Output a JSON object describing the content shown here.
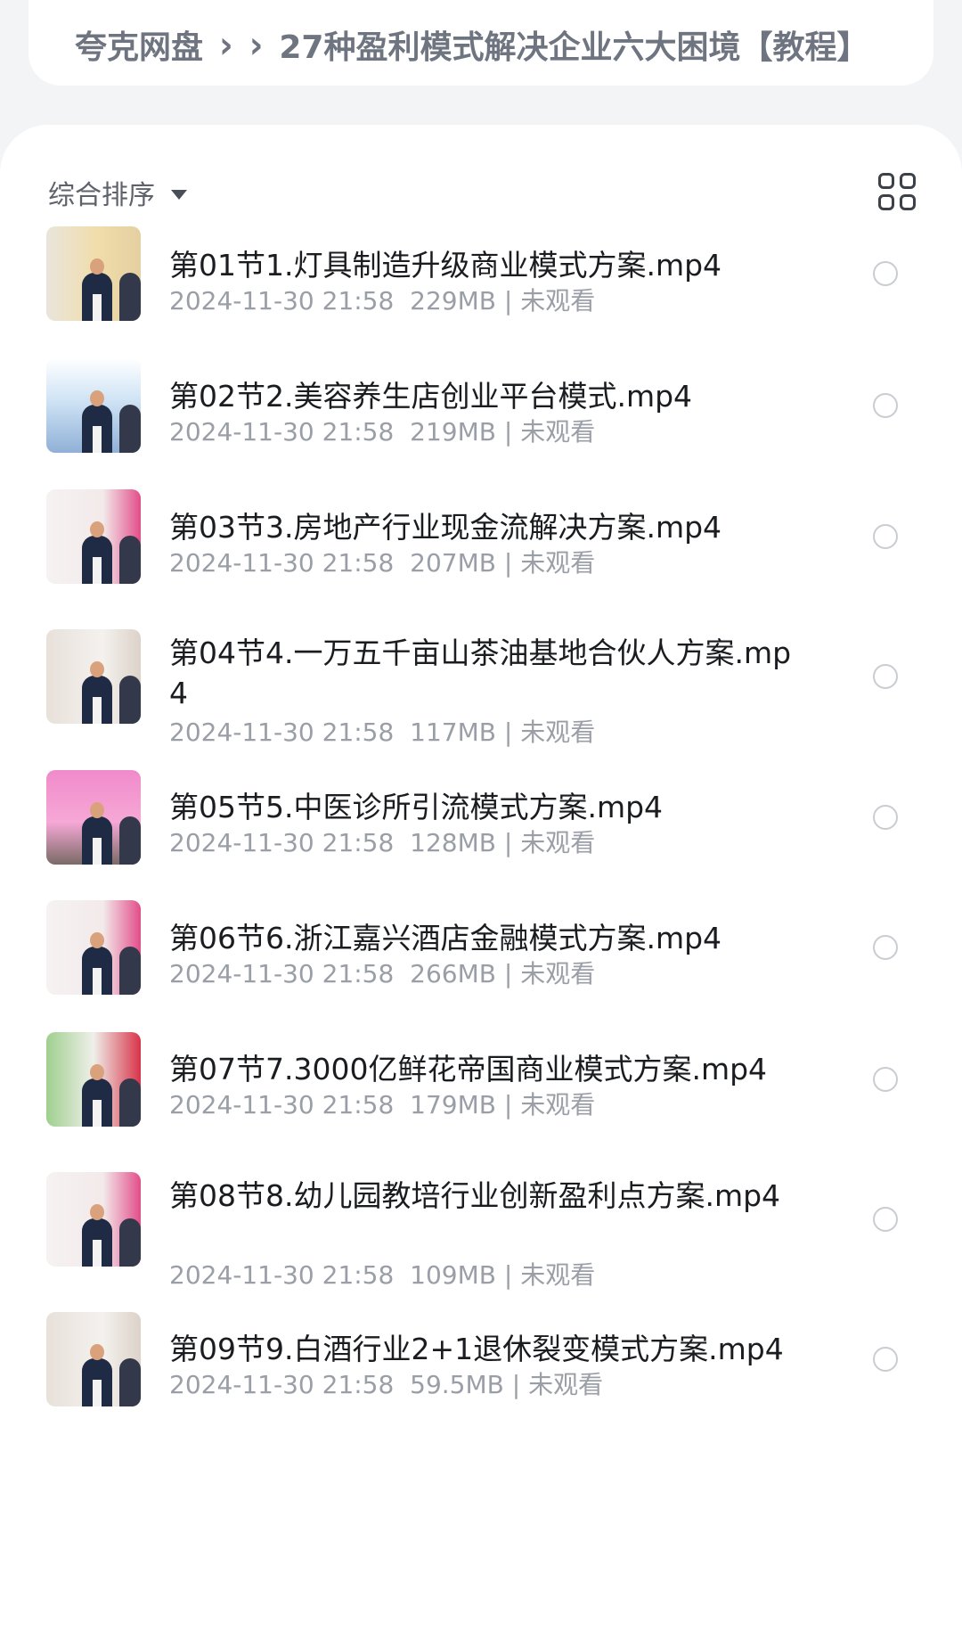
{
  "breadcrumb": {
    "root": "夸克网盘",
    "separator": "›",
    "current": "27种盈利模式解决企业六大困境【教程】"
  },
  "toolbar": {
    "sort_label": "综合排序",
    "view_icon": "grid-view-icon"
  },
  "files": [
    {
      "name": "第01节1.灯具制造升级商业模式方案.mp4",
      "date": "2024-11-30 21:58",
      "size": "229MB",
      "status": "未观看",
      "thumb": "board-yellow"
    },
    {
      "name": "第02节2.美容养生店创业平台模式.mp4",
      "date": "2024-11-30 21:58",
      "size": "219MB",
      "status": "未观看",
      "thumb": "stage-blue"
    },
    {
      "name": "第03节3.房地产行业现金流解决方案.mp4",
      "date": "2024-11-30 21:58",
      "size": "207MB",
      "status": "未观看",
      "thumb": "board-pink"
    },
    {
      "name": "第04节4.一万五千亩山茶油基地合伙人方案.mp4",
      "date": "2024-11-30 21:58",
      "size": "117MB",
      "status": "未观看",
      "thumb": "board-white"
    },
    {
      "name": "第05节5.中医诊所引流模式方案.mp4",
      "date": "2024-11-30 21:58",
      "size": "128MB",
      "status": "未观看",
      "thumb": "stage-pink"
    },
    {
      "name": "第06节6.浙江嘉兴酒店金融模式方案.mp4",
      "date": "2024-11-30 21:58",
      "size": "266MB",
      "status": "未观看",
      "thumb": "board-pink"
    },
    {
      "name": "第07节7.3000亿鲜花帝国商业模式方案.mp4",
      "date": "2024-11-30 21:58",
      "size": "179MB",
      "status": "未观看",
      "thumb": "board-green"
    },
    {
      "name": "第08节8.幼儿园教培行业创新盈利点方案.mp4",
      "date": "2024-11-30 21:58",
      "size": "109MB",
      "status": "未观看",
      "thumb": "board-pink"
    },
    {
      "name": "第09节9.白酒行业2+1退休裂变模式方案.mp4",
      "date": "2024-11-30 21:58",
      "size": "59.5MB",
      "status": "未观看",
      "thumb": "board-white"
    }
  ]
}
